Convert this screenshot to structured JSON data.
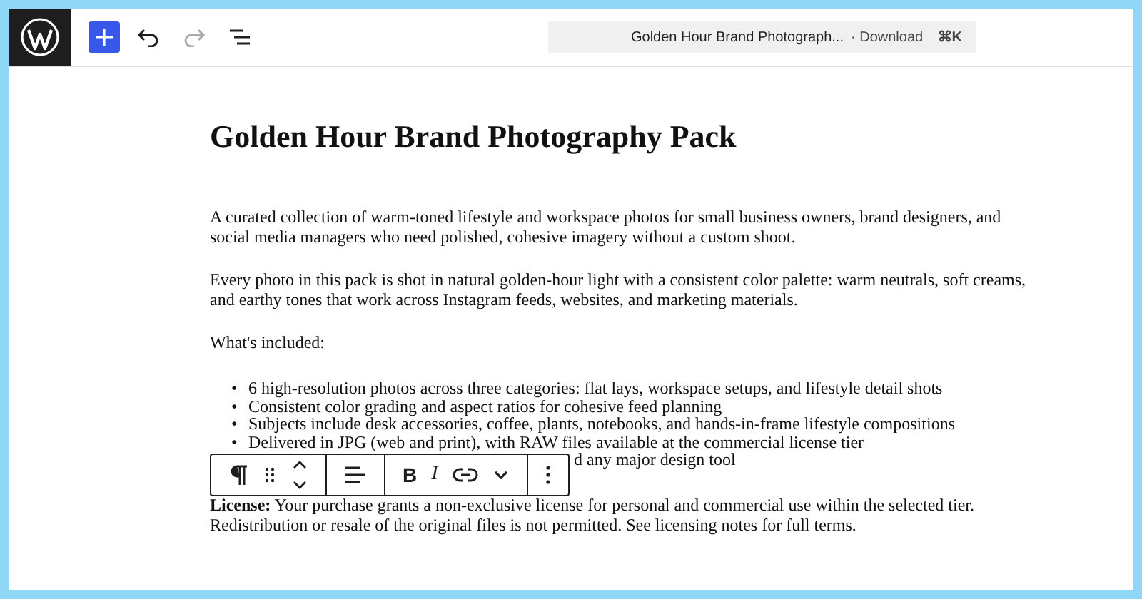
{
  "header": {
    "command_bar": {
      "title": "Golden Hour Brand Photograph...",
      "suffix": "· Download",
      "shortcut": "⌘K"
    },
    "undo_disabled": false,
    "redo_disabled": true
  },
  "title": "Golden Hour Brand Photography Pack",
  "paragraphs": [
    "A curated collection of warm-toned lifestyle and workspace photos for small business owners, brand designers, and social media managers who need polished, cohesive imagery without a custom shoot.",
    "Every photo in this pack is shot in natural golden-hour light with a consistent color palette: warm neutrals, soft creams, and earthy tones that work across Instagram feeds, websites, and marketing materials.",
    "What's included:"
  ],
  "block_toolbar": {
    "bold": "B",
    "italic": "I"
  },
  "list": [
    {
      "text": "6 high-resolution photos across three categories: flat lays, workspace setups, and lifestyle detail shots",
      "covered": false,
      "marker": "•"
    },
    {
      "text": "Consistent color grading and aspect ratios for cohesive feed planning",
      "covered": false,
      "marker": "•"
    },
    {
      "text": "Subjects include desk accessories, coffee, plants, notebooks, and hands-in-frame lifestyle compositions",
      "covered": false,
      "marker": "•"
    },
    {
      "text": "Delivered in JPG (web and print), with RAW files available at the commercial license tier",
      "covered": false,
      "marker": "•"
    },
    {
      "text": "d any major design tool",
      "covered": true
    }
  ],
  "license": "**License:** Your purchase grants a non-exclusive license for personal and commercial use within the selected tier. Redistribution or resale of the original files is not permitted. See licensing notes for full terms."
}
